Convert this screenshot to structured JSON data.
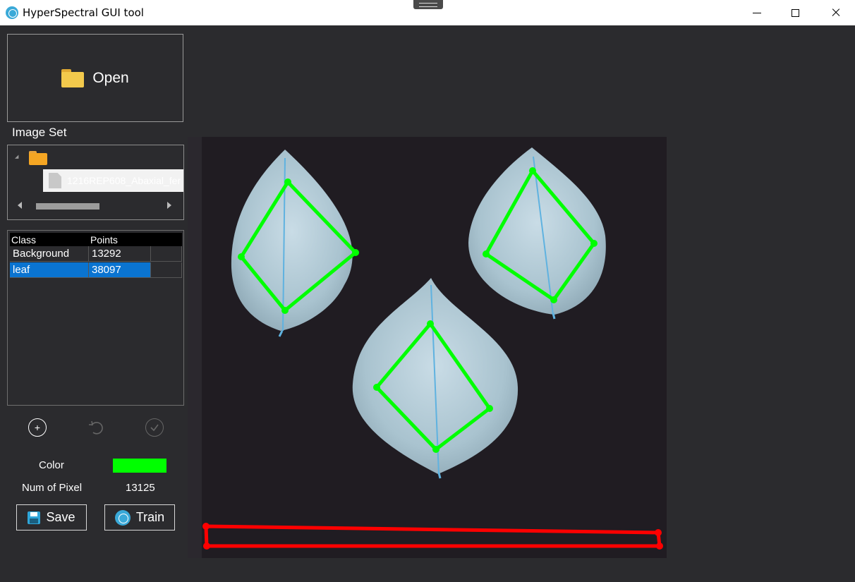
{
  "window": {
    "title": "HyperSpectral GUI tool"
  },
  "sidebar": {
    "open_label": "Open",
    "image_set_label": "Image Set",
    "tree": {
      "file_name": "1216REP608_Abaxial_fer"
    },
    "class_table": {
      "headers": [
        "Class",
        "Points"
      ],
      "rows": [
        {
          "class": "Background",
          "points": "13292"
        },
        {
          "class": "leaf",
          "points": "38097"
        }
      ],
      "selected_index": 1
    },
    "add_symbol": "+",
    "color_label": "Color",
    "color_value": "#00ff00",
    "num_pixel_label": "Num of Pixel",
    "num_pixel_value": "13125",
    "save_label": "Save",
    "train_label": "Train"
  },
  "annotations": {
    "leaf_color": "#00ff00",
    "background_color": "#ff0000"
  }
}
